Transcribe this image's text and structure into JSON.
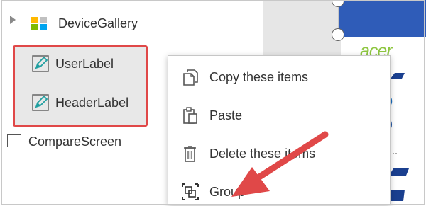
{
  "tree": {
    "gallery_label": "DeviceGallery",
    "user_label": "UserLabel",
    "header_label": "HeaderLabel",
    "compare_label": "CompareScreen"
  },
  "canvas": {
    "brand_logo": "acer"
  },
  "context_menu": {
    "items": [
      {
        "label": "Copy these items",
        "icon": "copy-icon"
      },
      {
        "label": "Paste",
        "icon": "paste-icon"
      },
      {
        "label": "Delete these items",
        "icon": "delete-icon"
      },
      {
        "label": "Group",
        "icon": "group-icon"
      }
    ]
  },
  "colors": {
    "selection_border": "#e04848",
    "annotation_arrow": "#e04848",
    "canvas_header": "#2f5cb8",
    "selection_fill": "#e8e8e8"
  }
}
